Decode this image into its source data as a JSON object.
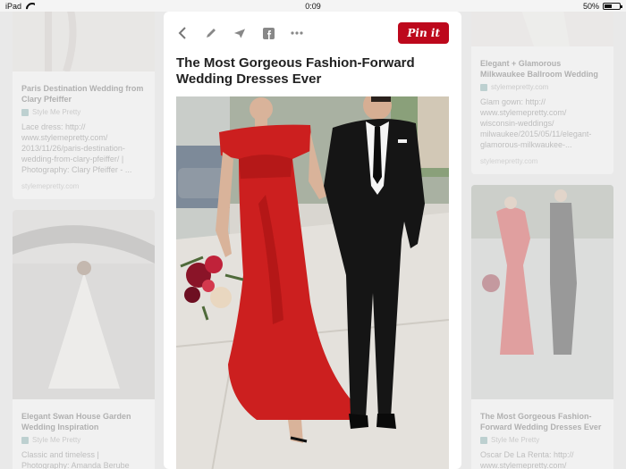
{
  "status": {
    "device": "iPad",
    "time": "0:09",
    "battery": "50%",
    "battery_level": 0.5
  },
  "left_cards": [
    {
      "title": "Paris Destination Wedding from Clary Pfeiffer",
      "source": "Style Me Pretty",
      "desc": "Lace dress: http:// www.stylemepretty.com/ 2013/11/26/paris-destination-wedding-from-clary-pfeiffer/ | Photography: Clary Pfeiffer - ...",
      "link": "stylemepretty.com"
    },
    {
      "title": "Elegant Swan House Garden Wedding Inspiration",
      "source": "Style Me Pretty",
      "desc": "Classic and timeless | Photography: Amanda Berube"
    }
  ],
  "right_cards": [
    {
      "title": "Elegant + Glamorous Milkwaukee Ballroom Wedding",
      "source": "stylemepretty.com",
      "desc": "Glam gown: http:// www.stylemepretty.com/ wisconsin-weddings/ milwaukee/2015/05/11/elegant-glamorous-milkwaukee-...",
      "link": "stylemepretty.com"
    },
    {
      "title": "The Most Gorgeous Fashion-Forward Wedding Dresses Ever",
      "source": "Style Me Pretty",
      "desc": "Oscar De La Renta: http:// www.stylemepretty.com/"
    }
  ],
  "pin": {
    "title": "The Most Gorgeous Fashion-Forward Wedding Dresses Ever",
    "pin_label": "Pin it",
    "icons": [
      "back-icon",
      "edit-icon",
      "send-icon",
      "facebook-icon",
      "more-icon"
    ]
  }
}
